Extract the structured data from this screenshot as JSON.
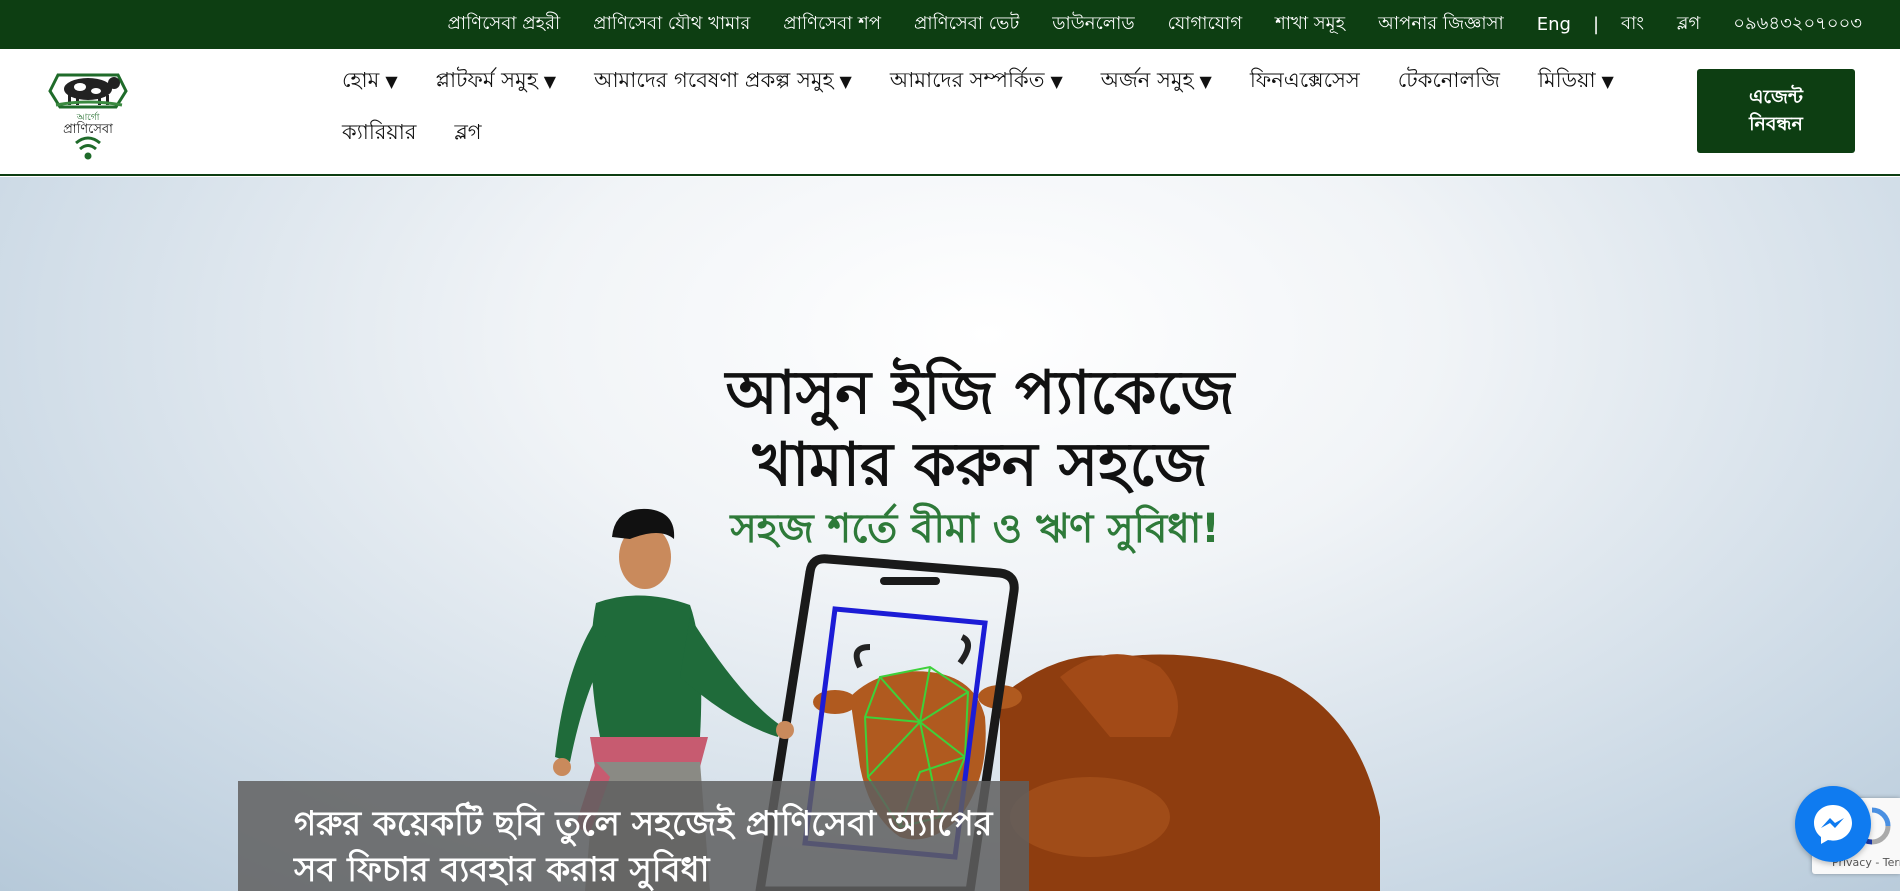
{
  "topbar": {
    "links": [
      "প্রাণিসেবা প্রহরী",
      "প্রাণিসেবা যৌথ খামার",
      "প্রাণিসেবা শপ",
      "প্রাণিসেবা ভেট",
      "ডাউনলোড",
      "যোগাযোগ",
      "শাখা সমূহ",
      "আপনার জিজ্ঞাসা"
    ],
    "lang_en": "Eng",
    "lang_sep": "|",
    "lang_bn": "বাং",
    "blog": "ব্লগ",
    "phone": "০৯৬৪৩২০৭০০৩"
  },
  "logo": {
    "text_small": "আর্গো",
    "text_main": "প্রাণিসেবা"
  },
  "nav": {
    "items": [
      {
        "label": "হোম",
        "caret": "▼"
      },
      {
        "label": "প্লাটফর্ম সমুহ",
        "caret": "▼"
      },
      {
        "label": "আমাদের গবেষণা প্রকল্প সমুহ",
        "caret": "▼"
      },
      {
        "label": "আমাদের সম্পর্কিত",
        "caret": "▼"
      },
      {
        "label": "অর্জন সমুহ",
        "caret": "▼"
      },
      {
        "label": "ফিনএক্সেসেস",
        "caret": ""
      },
      {
        "label": "টেকনোলজি",
        "caret": ""
      },
      {
        "label": "মিডিয়া",
        "caret": "▼"
      },
      {
        "label": "ক্যারিয়ার",
        "caret": ""
      },
      {
        "label": "ব্লগ",
        "caret": ""
      }
    ],
    "agent_button_line1": "এজেন্ট",
    "agent_button_line2": "নিবন্ধন"
  },
  "hero": {
    "headline_line1": "আসুন ইজি প্যাকেজে",
    "headline_line2": "খামার করুন সহজে",
    "subheadline": "সহজ শর্তে বীমা ও ঋণ সুবিধা!",
    "caption": "গরুর কয়েকটি ছবি তুলে সহজেই প্রাণিসেবা অ্যাপের সব ফিচার ব্যবহার করার সুবিধা"
  },
  "recaptcha": {
    "text": "Privacy - Terms"
  },
  "colors": {
    "brand_green": "#0d3e12",
    "accent_green": "#2e7a39",
    "messenger_blue": "#0f7bf0"
  }
}
